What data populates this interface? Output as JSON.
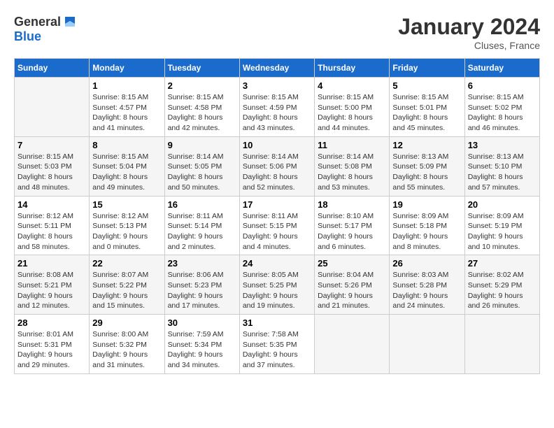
{
  "header": {
    "logo_general": "General",
    "logo_blue": "Blue",
    "month_title": "January 2024",
    "location": "Cluses, France"
  },
  "weekdays": [
    "Sunday",
    "Monday",
    "Tuesday",
    "Wednesday",
    "Thursday",
    "Friday",
    "Saturday"
  ],
  "weeks": [
    [
      {
        "day": "",
        "sunrise": "",
        "sunset": "",
        "daylight": ""
      },
      {
        "day": "1",
        "sunrise": "Sunrise: 8:15 AM",
        "sunset": "Sunset: 4:57 PM",
        "daylight": "Daylight: 8 hours and 41 minutes."
      },
      {
        "day": "2",
        "sunrise": "Sunrise: 8:15 AM",
        "sunset": "Sunset: 4:58 PM",
        "daylight": "Daylight: 8 hours and 42 minutes."
      },
      {
        "day": "3",
        "sunrise": "Sunrise: 8:15 AM",
        "sunset": "Sunset: 4:59 PM",
        "daylight": "Daylight: 8 hours and 43 minutes."
      },
      {
        "day": "4",
        "sunrise": "Sunrise: 8:15 AM",
        "sunset": "Sunset: 5:00 PM",
        "daylight": "Daylight: 8 hours and 44 minutes."
      },
      {
        "day": "5",
        "sunrise": "Sunrise: 8:15 AM",
        "sunset": "Sunset: 5:01 PM",
        "daylight": "Daylight: 8 hours and 45 minutes."
      },
      {
        "day": "6",
        "sunrise": "Sunrise: 8:15 AM",
        "sunset": "Sunset: 5:02 PM",
        "daylight": "Daylight: 8 hours and 46 minutes."
      }
    ],
    [
      {
        "day": "7",
        "sunrise": "Sunrise: 8:15 AM",
        "sunset": "Sunset: 5:03 PM",
        "daylight": "Daylight: 8 hours and 48 minutes."
      },
      {
        "day": "8",
        "sunrise": "Sunrise: 8:15 AM",
        "sunset": "Sunset: 5:04 PM",
        "daylight": "Daylight: 8 hours and 49 minutes."
      },
      {
        "day": "9",
        "sunrise": "Sunrise: 8:14 AM",
        "sunset": "Sunset: 5:05 PM",
        "daylight": "Daylight: 8 hours and 50 minutes."
      },
      {
        "day": "10",
        "sunrise": "Sunrise: 8:14 AM",
        "sunset": "Sunset: 5:06 PM",
        "daylight": "Daylight: 8 hours and 52 minutes."
      },
      {
        "day": "11",
        "sunrise": "Sunrise: 8:14 AM",
        "sunset": "Sunset: 5:08 PM",
        "daylight": "Daylight: 8 hours and 53 minutes."
      },
      {
        "day": "12",
        "sunrise": "Sunrise: 8:13 AM",
        "sunset": "Sunset: 5:09 PM",
        "daylight": "Daylight: 8 hours and 55 minutes."
      },
      {
        "day": "13",
        "sunrise": "Sunrise: 8:13 AM",
        "sunset": "Sunset: 5:10 PM",
        "daylight": "Daylight: 8 hours and 57 minutes."
      }
    ],
    [
      {
        "day": "14",
        "sunrise": "Sunrise: 8:12 AM",
        "sunset": "Sunset: 5:11 PM",
        "daylight": "Daylight: 8 hours and 58 minutes."
      },
      {
        "day": "15",
        "sunrise": "Sunrise: 8:12 AM",
        "sunset": "Sunset: 5:13 PM",
        "daylight": "Daylight: 9 hours and 0 minutes."
      },
      {
        "day": "16",
        "sunrise": "Sunrise: 8:11 AM",
        "sunset": "Sunset: 5:14 PM",
        "daylight": "Daylight: 9 hours and 2 minutes."
      },
      {
        "day": "17",
        "sunrise": "Sunrise: 8:11 AM",
        "sunset": "Sunset: 5:15 PM",
        "daylight": "Daylight: 9 hours and 4 minutes."
      },
      {
        "day": "18",
        "sunrise": "Sunrise: 8:10 AM",
        "sunset": "Sunset: 5:17 PM",
        "daylight": "Daylight: 9 hours and 6 minutes."
      },
      {
        "day": "19",
        "sunrise": "Sunrise: 8:09 AM",
        "sunset": "Sunset: 5:18 PM",
        "daylight": "Daylight: 9 hours and 8 minutes."
      },
      {
        "day": "20",
        "sunrise": "Sunrise: 8:09 AM",
        "sunset": "Sunset: 5:19 PM",
        "daylight": "Daylight: 9 hours and 10 minutes."
      }
    ],
    [
      {
        "day": "21",
        "sunrise": "Sunrise: 8:08 AM",
        "sunset": "Sunset: 5:21 PM",
        "daylight": "Daylight: 9 hours and 12 minutes."
      },
      {
        "day": "22",
        "sunrise": "Sunrise: 8:07 AM",
        "sunset": "Sunset: 5:22 PM",
        "daylight": "Daylight: 9 hours and 15 minutes."
      },
      {
        "day": "23",
        "sunrise": "Sunrise: 8:06 AM",
        "sunset": "Sunset: 5:23 PM",
        "daylight": "Daylight: 9 hours and 17 minutes."
      },
      {
        "day": "24",
        "sunrise": "Sunrise: 8:05 AM",
        "sunset": "Sunset: 5:25 PM",
        "daylight": "Daylight: 9 hours and 19 minutes."
      },
      {
        "day": "25",
        "sunrise": "Sunrise: 8:04 AM",
        "sunset": "Sunset: 5:26 PM",
        "daylight": "Daylight: 9 hours and 21 minutes."
      },
      {
        "day": "26",
        "sunrise": "Sunrise: 8:03 AM",
        "sunset": "Sunset: 5:28 PM",
        "daylight": "Daylight: 9 hours and 24 minutes."
      },
      {
        "day": "27",
        "sunrise": "Sunrise: 8:02 AM",
        "sunset": "Sunset: 5:29 PM",
        "daylight": "Daylight: 9 hours and 26 minutes."
      }
    ],
    [
      {
        "day": "28",
        "sunrise": "Sunrise: 8:01 AM",
        "sunset": "Sunset: 5:31 PM",
        "daylight": "Daylight: 9 hours and 29 minutes."
      },
      {
        "day": "29",
        "sunrise": "Sunrise: 8:00 AM",
        "sunset": "Sunset: 5:32 PM",
        "daylight": "Daylight: 9 hours and 31 minutes."
      },
      {
        "day": "30",
        "sunrise": "Sunrise: 7:59 AM",
        "sunset": "Sunset: 5:34 PM",
        "daylight": "Daylight: 9 hours and 34 minutes."
      },
      {
        "day": "31",
        "sunrise": "Sunrise: 7:58 AM",
        "sunset": "Sunset: 5:35 PM",
        "daylight": "Daylight: 9 hours and 37 minutes."
      },
      {
        "day": "",
        "sunrise": "",
        "sunset": "",
        "daylight": ""
      },
      {
        "day": "",
        "sunrise": "",
        "sunset": "",
        "daylight": ""
      },
      {
        "day": "",
        "sunrise": "",
        "sunset": "",
        "daylight": ""
      }
    ]
  ]
}
